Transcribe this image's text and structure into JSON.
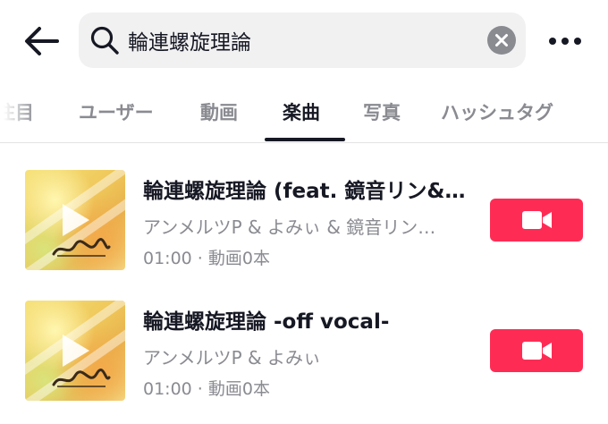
{
  "search": {
    "query": "輪連螺旋理論"
  },
  "tabs": [
    {
      "label": "注目"
    },
    {
      "label": "ユーザー"
    },
    {
      "label": "動画"
    },
    {
      "label": "楽曲"
    },
    {
      "label": "写真"
    },
    {
      "label": "ハッシュタグ"
    }
  ],
  "active_tab": "楽曲",
  "results": [
    {
      "title": "輪連螺旋理論 (feat. 鏡音リン&…",
      "artist": "アンメルツP & よみぃ & 鏡音リン…",
      "duration": "01:00",
      "separator": " · ",
      "video_count": "動画0本"
    },
    {
      "title": "輪連螺旋理論 -off vocal-",
      "artist": "アンメルツP & よみぃ",
      "duration": "01:00",
      "separator": " · ",
      "video_count": "動画0本"
    }
  ],
  "icons": {
    "back": "arrow-left-icon",
    "search": "search-icon",
    "clear": "clear-circle-icon",
    "more": "more-horizontal-icon",
    "use_sound": "video-camera-icon",
    "play": "play-icon"
  },
  "colors": {
    "accent": "#fe2c55",
    "text_primary": "#161823",
    "text_secondary": "#8a8b91",
    "search_bg": "#f1f1f2"
  }
}
